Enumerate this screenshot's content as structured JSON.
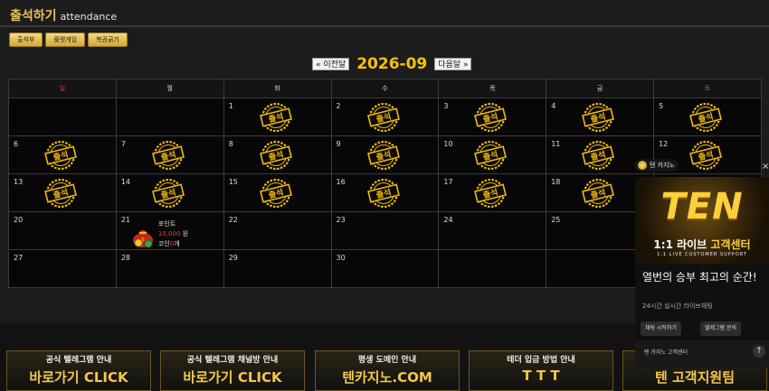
{
  "header": {
    "title": "출석하기",
    "subtitle": "attendance"
  },
  "tabs": [
    {
      "label": "출석부"
    },
    {
      "label": "룰렛게임"
    },
    {
      "label": "복권긁기"
    }
  ],
  "nav": {
    "prev": "« 이전달",
    "month": "2026-09",
    "next": "다음달 »"
  },
  "weekdays": [
    "일",
    "월",
    "화",
    "수",
    "목",
    "금",
    "토"
  ],
  "stamp_text": "출석",
  "weeks": [
    [
      "",
      "",
      "1",
      "2",
      "3",
      "4",
      "5"
    ],
    [
      "6",
      "7",
      "8",
      "9",
      "10",
      "11",
      "12"
    ],
    [
      "13",
      "14",
      "15",
      "16",
      "17",
      "18",
      "19"
    ],
    [
      "20",
      "21",
      "22",
      "23",
      "24",
      "25",
      ""
    ],
    [
      "27",
      "28",
      "29",
      "30",
      "",
      "",
      ""
    ]
  ],
  "stamped_days": [
    "1",
    "2",
    "3",
    "4",
    "5",
    "6",
    "7",
    "8",
    "9",
    "10",
    "11",
    "12",
    "13",
    "14",
    "15",
    "16",
    "17",
    "18"
  ],
  "reward": {
    "day": "21",
    "point_label": "포인트",
    "point_value": "10,000",
    "point_unit": "원",
    "coin_label": "코인",
    "coin_value": "0",
    "coin_unit": "개"
  },
  "widget": {
    "label": "텐 카지노",
    "banner_big": "TEN",
    "banner_live_a": "1:1 라이브 ",
    "banner_live_b": "고객센터",
    "banner_support": "1:1 LIVE CUSTOMER SUPPORT",
    "title": "열번의 승부 최고의 순간!",
    "sub": "24시간 실시간 라이브채팅",
    "btn_chat": "채팅 시작하기",
    "btn_telegram": "텔레그램 문의",
    "footer": "텐 카지노 고객센터",
    "close": "×",
    "up": "↑"
  },
  "banners": [
    {
      "title": "공식 텔레그램 안내",
      "big": "바로가기 CLICK"
    },
    {
      "title": "공식 텔레그램 채널방 안내",
      "big": "바로가기 CLICK"
    },
    {
      "title": "평생 도메인 안내",
      "big": "텐카지노.COM"
    },
    {
      "title": "테더 입금 방법 안내",
      "big": "T T T"
    },
    {
      "title": "",
      "big": "텐 고객지원팀"
    }
  ],
  "colors": {
    "accent": "#f5c400",
    "sunday": "#e03030",
    "saturday": "#3a7de0",
    "point": "#ff3b2b"
  }
}
